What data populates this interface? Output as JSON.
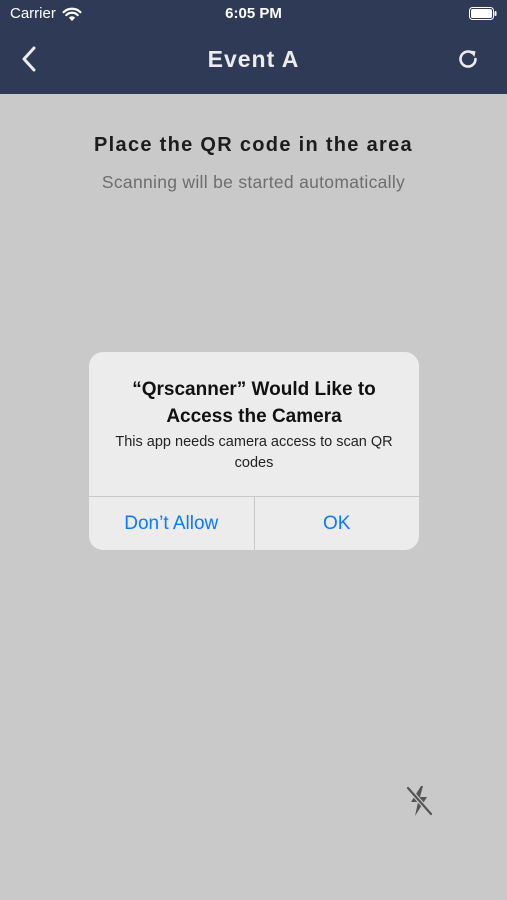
{
  "status_bar": {
    "carrier": "Carrier",
    "time": "6:05 PM",
    "wifi_icon": "wifi-icon",
    "battery_icon": "battery-icon"
  },
  "nav": {
    "title": "Event A",
    "back_icon": "chevron-left-icon",
    "refresh_icon": "refresh-icon"
  },
  "scanner": {
    "title": "Place the QR code in the area",
    "subtitle": "Scanning will be started automatically",
    "flash_icon": "flash-off-icon"
  },
  "alert": {
    "title": "“Qrscanner” Would Like to Access the Camera",
    "message": "This app needs camera access to scan QR codes",
    "buttons": [
      {
        "label": "Don’t Allow"
      },
      {
        "label": "OK"
      }
    ]
  },
  "colors": {
    "nav_background": "#2f3a57",
    "camera_background": "#c9c9c9",
    "alert_background": "#ececec",
    "accent": "#0a7afe"
  }
}
